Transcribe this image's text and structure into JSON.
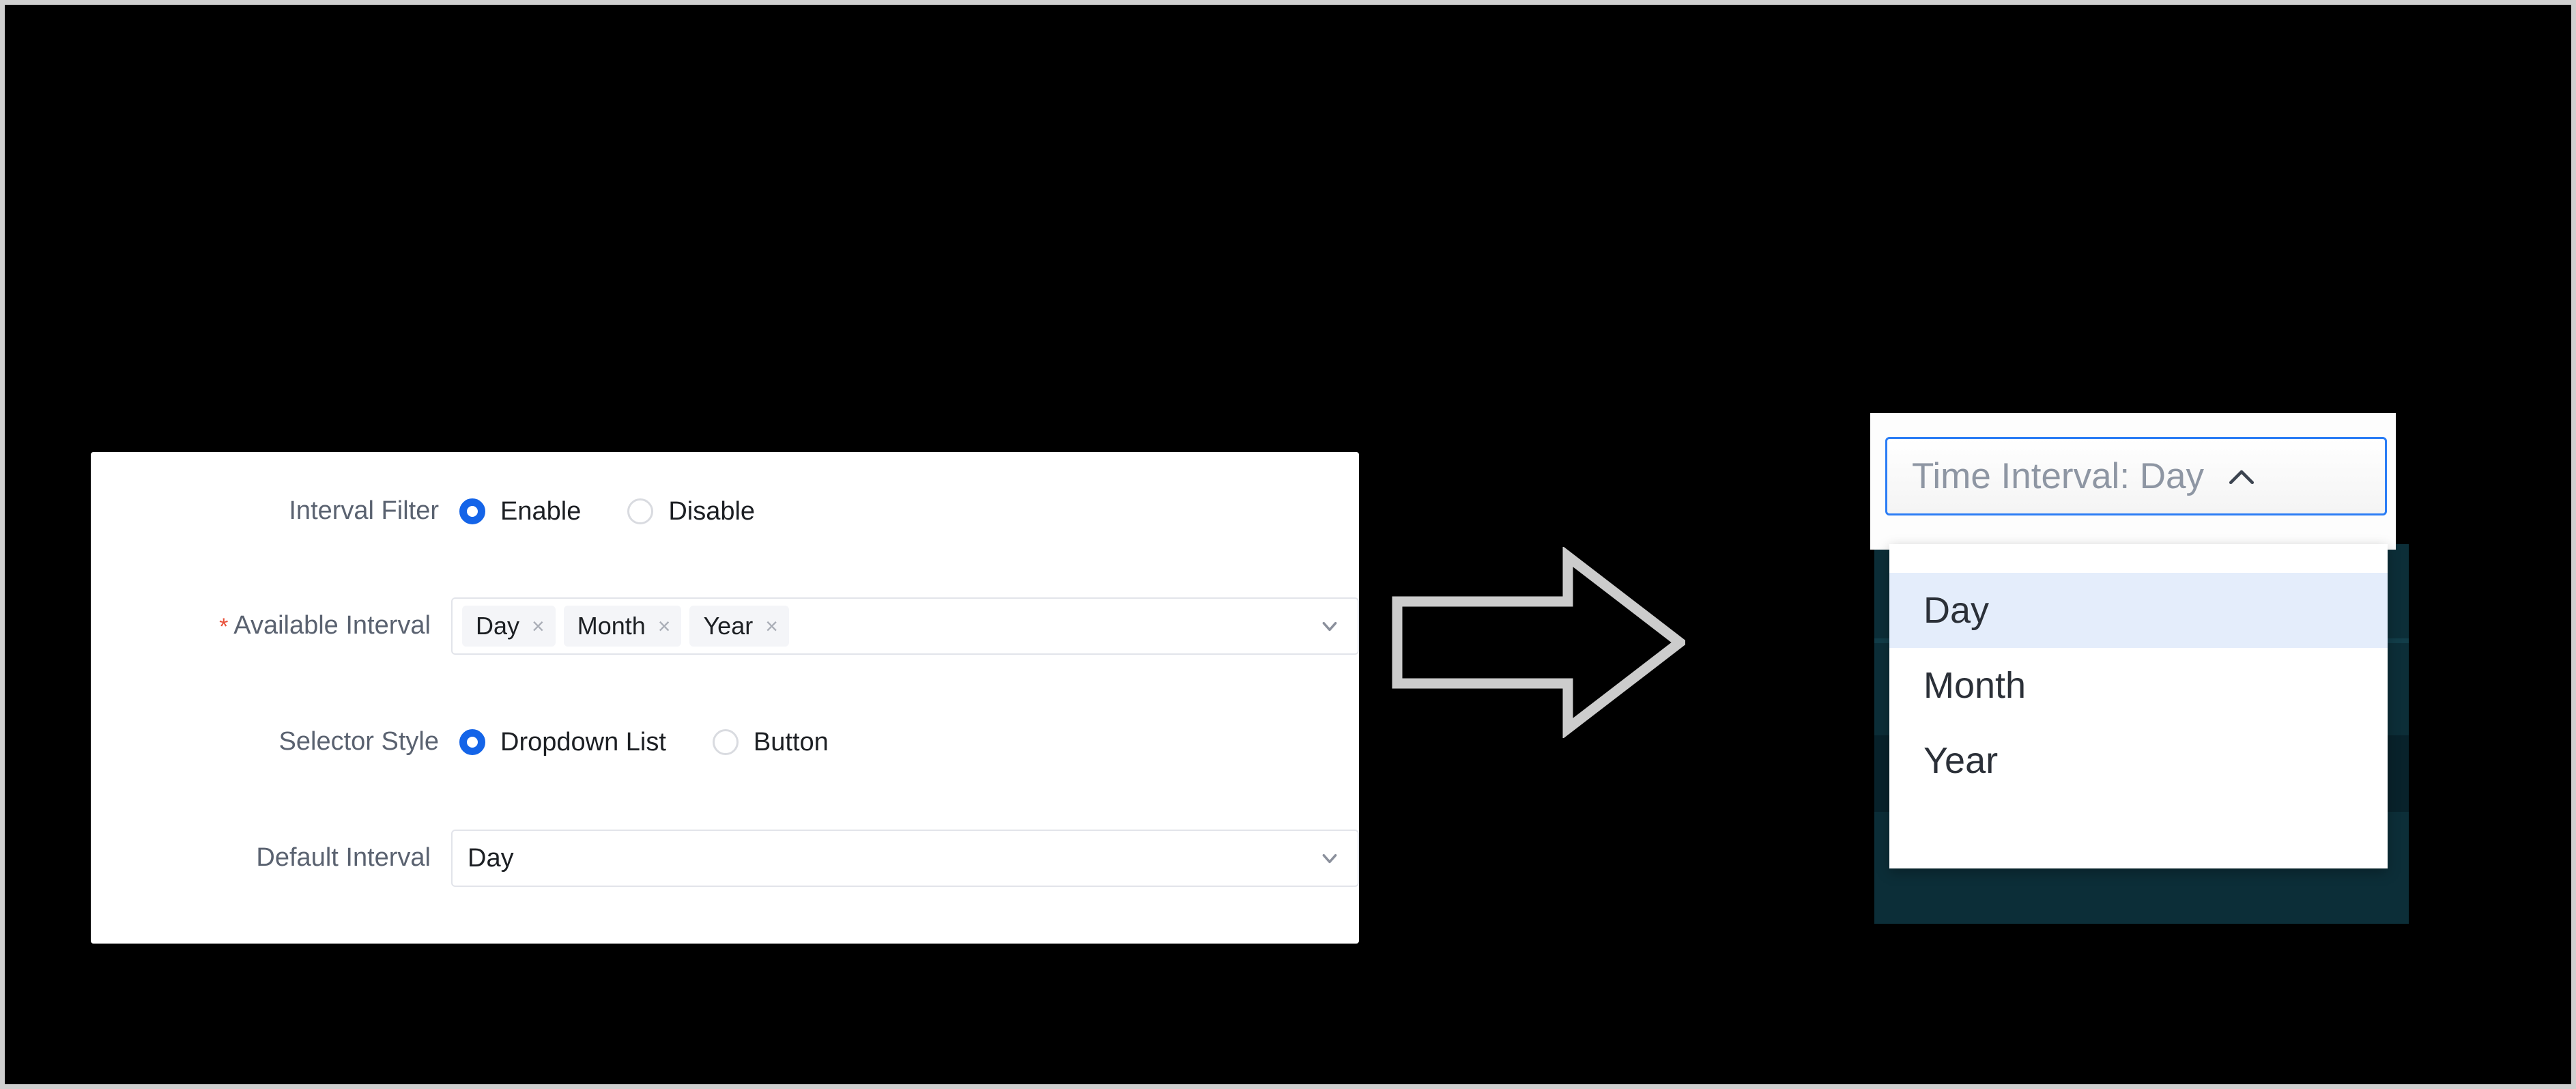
{
  "settings_panel": {
    "rows": [
      {
        "label": "Interval Filter",
        "required": false,
        "type": "radio",
        "options": [
          {
            "label": "Enable",
            "checked": true
          },
          {
            "label": "Disable",
            "checked": false
          }
        ]
      },
      {
        "label": "Available Interval",
        "required": true,
        "required_marker": "*",
        "type": "multiselect",
        "chips": [
          {
            "label": "Day",
            "remove_icon": "×"
          },
          {
            "label": "Month",
            "remove_icon": "×"
          },
          {
            "label": "Year",
            "remove_icon": "×"
          }
        ]
      },
      {
        "label": "Selector Style",
        "required": false,
        "type": "radio",
        "options": [
          {
            "label": "Dropdown List",
            "checked": true
          },
          {
            "label": "Button",
            "checked": false
          }
        ]
      },
      {
        "label": "Default Interval",
        "required": false,
        "type": "select",
        "value": "Day"
      }
    ]
  },
  "preview_widget": {
    "trigger_label": "Time Interval: Day",
    "expanded": true,
    "menu_items": [
      {
        "label": "Day",
        "selected": true
      },
      {
        "label": "Month",
        "selected": false
      },
      {
        "label": "Year",
        "selected": false
      }
    ]
  },
  "colors": {
    "accent_blue": "#1464e8",
    "focus_blue": "#2b7df5",
    "menu_highlight": "#e4edfb",
    "required_red": "#e8503a",
    "widget_backdrop_teal": "#0c2e38",
    "arrow_stroke": "#cccccc",
    "canvas_background": "#000000"
  }
}
